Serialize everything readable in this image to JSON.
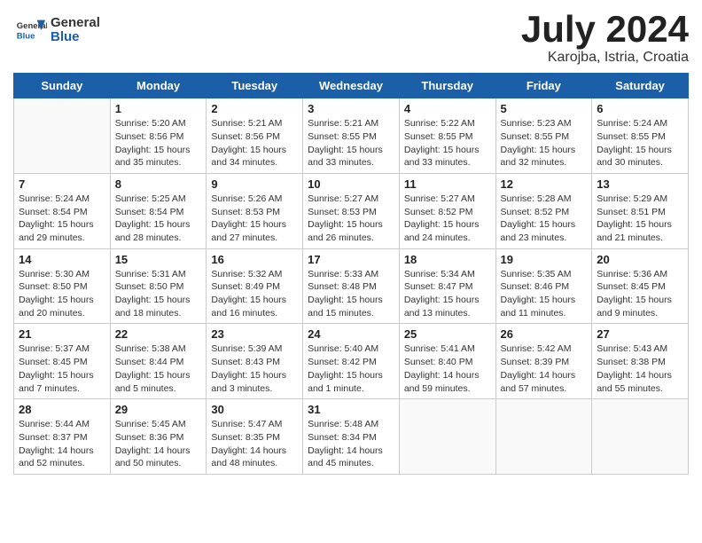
{
  "logo": {
    "general": "General",
    "blue": "Blue"
  },
  "title": "July 2024",
  "subtitle": "Karojba, Istria, Croatia",
  "weekdays": [
    "Sunday",
    "Monday",
    "Tuesday",
    "Wednesday",
    "Thursday",
    "Friday",
    "Saturday"
  ],
  "weeks": [
    [
      {
        "day": "",
        "info": ""
      },
      {
        "day": "1",
        "info": "Sunrise: 5:20 AM\nSunset: 8:56 PM\nDaylight: 15 hours\nand 35 minutes."
      },
      {
        "day": "2",
        "info": "Sunrise: 5:21 AM\nSunset: 8:56 PM\nDaylight: 15 hours\nand 34 minutes."
      },
      {
        "day": "3",
        "info": "Sunrise: 5:21 AM\nSunset: 8:55 PM\nDaylight: 15 hours\nand 33 minutes."
      },
      {
        "day": "4",
        "info": "Sunrise: 5:22 AM\nSunset: 8:55 PM\nDaylight: 15 hours\nand 33 minutes."
      },
      {
        "day": "5",
        "info": "Sunrise: 5:23 AM\nSunset: 8:55 PM\nDaylight: 15 hours\nand 32 minutes."
      },
      {
        "day": "6",
        "info": "Sunrise: 5:24 AM\nSunset: 8:55 PM\nDaylight: 15 hours\nand 30 minutes."
      }
    ],
    [
      {
        "day": "7",
        "info": "Sunrise: 5:24 AM\nSunset: 8:54 PM\nDaylight: 15 hours\nand 29 minutes."
      },
      {
        "day": "8",
        "info": "Sunrise: 5:25 AM\nSunset: 8:54 PM\nDaylight: 15 hours\nand 28 minutes."
      },
      {
        "day": "9",
        "info": "Sunrise: 5:26 AM\nSunset: 8:53 PM\nDaylight: 15 hours\nand 27 minutes."
      },
      {
        "day": "10",
        "info": "Sunrise: 5:27 AM\nSunset: 8:53 PM\nDaylight: 15 hours\nand 26 minutes."
      },
      {
        "day": "11",
        "info": "Sunrise: 5:27 AM\nSunset: 8:52 PM\nDaylight: 15 hours\nand 24 minutes."
      },
      {
        "day": "12",
        "info": "Sunrise: 5:28 AM\nSunset: 8:52 PM\nDaylight: 15 hours\nand 23 minutes."
      },
      {
        "day": "13",
        "info": "Sunrise: 5:29 AM\nSunset: 8:51 PM\nDaylight: 15 hours\nand 21 minutes."
      }
    ],
    [
      {
        "day": "14",
        "info": "Sunrise: 5:30 AM\nSunset: 8:50 PM\nDaylight: 15 hours\nand 20 minutes."
      },
      {
        "day": "15",
        "info": "Sunrise: 5:31 AM\nSunset: 8:50 PM\nDaylight: 15 hours\nand 18 minutes."
      },
      {
        "day": "16",
        "info": "Sunrise: 5:32 AM\nSunset: 8:49 PM\nDaylight: 15 hours\nand 16 minutes."
      },
      {
        "day": "17",
        "info": "Sunrise: 5:33 AM\nSunset: 8:48 PM\nDaylight: 15 hours\nand 15 minutes."
      },
      {
        "day": "18",
        "info": "Sunrise: 5:34 AM\nSunset: 8:47 PM\nDaylight: 15 hours\nand 13 minutes."
      },
      {
        "day": "19",
        "info": "Sunrise: 5:35 AM\nSunset: 8:46 PM\nDaylight: 15 hours\nand 11 minutes."
      },
      {
        "day": "20",
        "info": "Sunrise: 5:36 AM\nSunset: 8:45 PM\nDaylight: 15 hours\nand 9 minutes."
      }
    ],
    [
      {
        "day": "21",
        "info": "Sunrise: 5:37 AM\nSunset: 8:45 PM\nDaylight: 15 hours\nand 7 minutes."
      },
      {
        "day": "22",
        "info": "Sunrise: 5:38 AM\nSunset: 8:44 PM\nDaylight: 15 hours\nand 5 minutes."
      },
      {
        "day": "23",
        "info": "Sunrise: 5:39 AM\nSunset: 8:43 PM\nDaylight: 15 hours\nand 3 minutes."
      },
      {
        "day": "24",
        "info": "Sunrise: 5:40 AM\nSunset: 8:42 PM\nDaylight: 15 hours\nand 1 minute."
      },
      {
        "day": "25",
        "info": "Sunrise: 5:41 AM\nSunset: 8:40 PM\nDaylight: 14 hours\nand 59 minutes."
      },
      {
        "day": "26",
        "info": "Sunrise: 5:42 AM\nSunset: 8:39 PM\nDaylight: 14 hours\nand 57 minutes."
      },
      {
        "day": "27",
        "info": "Sunrise: 5:43 AM\nSunset: 8:38 PM\nDaylight: 14 hours\nand 55 minutes."
      }
    ],
    [
      {
        "day": "28",
        "info": "Sunrise: 5:44 AM\nSunset: 8:37 PM\nDaylight: 14 hours\nand 52 minutes."
      },
      {
        "day": "29",
        "info": "Sunrise: 5:45 AM\nSunset: 8:36 PM\nDaylight: 14 hours\nand 50 minutes."
      },
      {
        "day": "30",
        "info": "Sunrise: 5:47 AM\nSunset: 8:35 PM\nDaylight: 14 hours\nand 48 minutes."
      },
      {
        "day": "31",
        "info": "Sunrise: 5:48 AM\nSunset: 8:34 PM\nDaylight: 14 hours\nand 45 minutes."
      },
      {
        "day": "",
        "info": ""
      },
      {
        "day": "",
        "info": ""
      },
      {
        "day": "",
        "info": ""
      }
    ]
  ]
}
